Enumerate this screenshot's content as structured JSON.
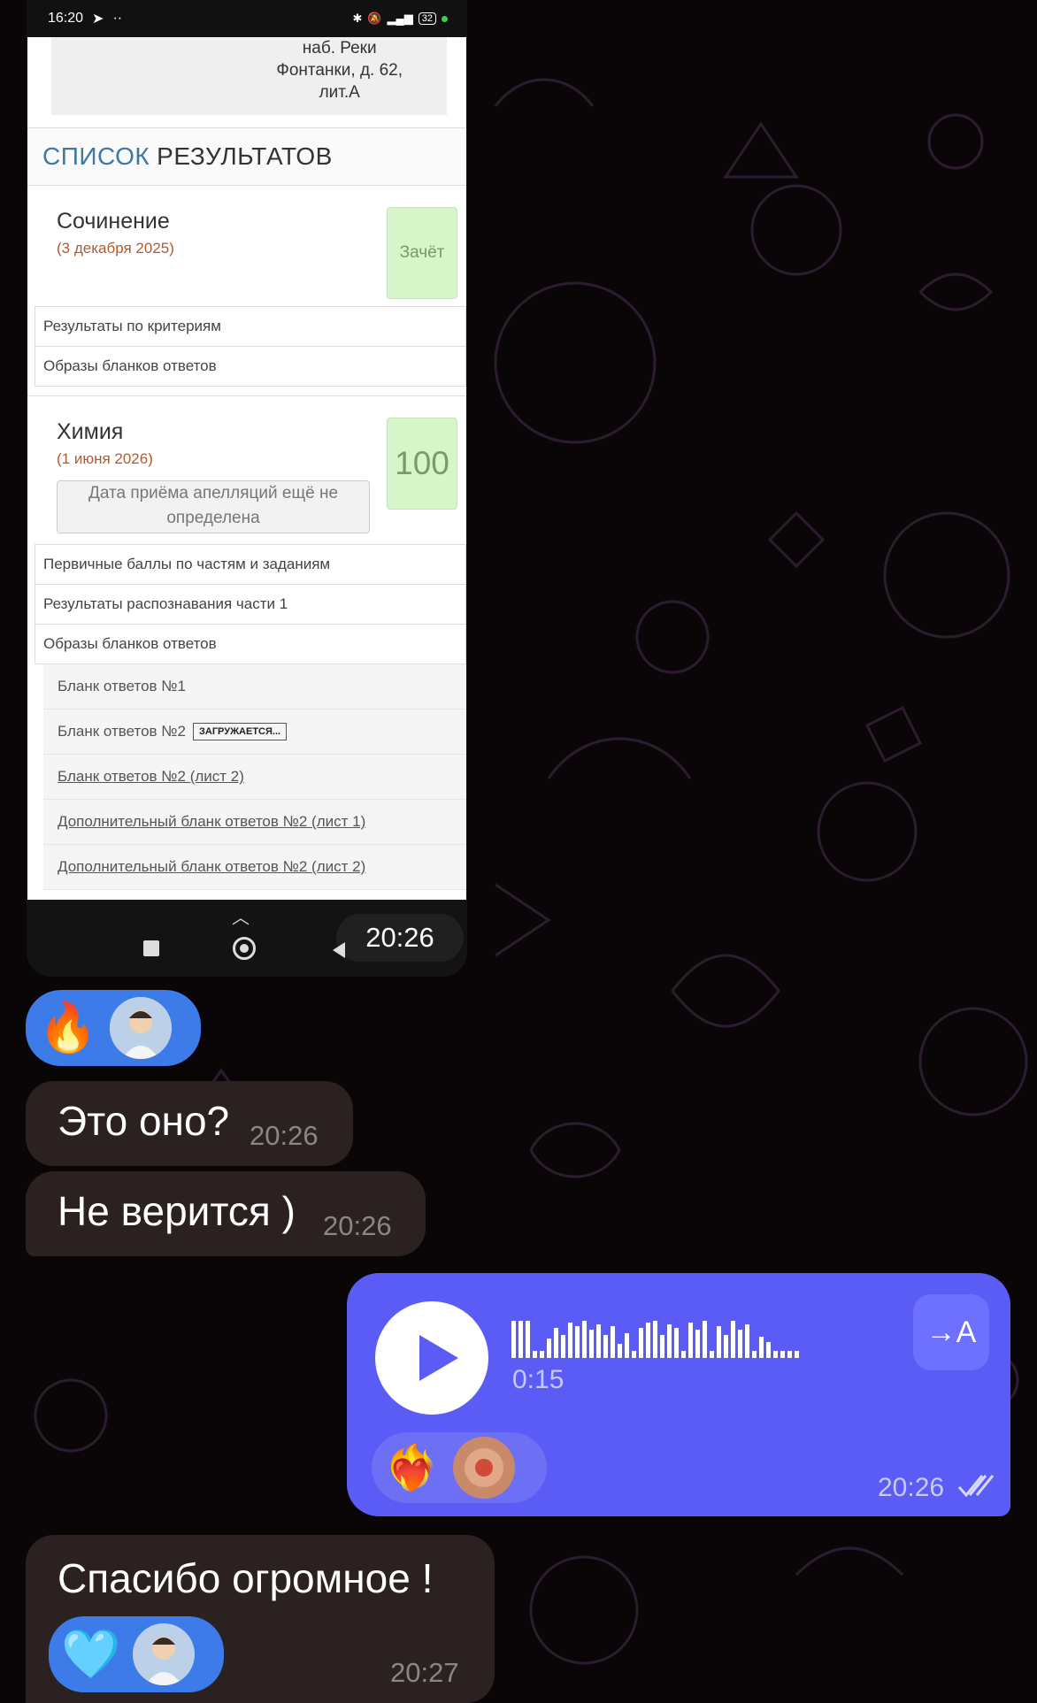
{
  "screenshot": {
    "status_bar": {
      "time": "16:20",
      "icons": [
        "telegram-icon",
        "more-dots-icon",
        "bluetooth-icon",
        "mute-icon",
        "signal-icon"
      ],
      "battery": "32"
    },
    "address_text": "наб. Реки\nФонтанки, д. 62,\nлит.А",
    "results_header": {
      "part1": "СПИСОК",
      "part2": "РЕЗУЛЬТАТОВ"
    },
    "exams": [
      {
        "name": "Сочинение",
        "date": "(3 декабря 2025)",
        "score": "Зачёт",
        "rows": [
          "Результаты по критериям",
          "Образы бланков ответов"
        ]
      },
      {
        "name": "Химия",
        "date": "(1 июня 2026)",
        "score": "100",
        "appeal": "Дата приёма апелляций ещё не определена",
        "rows": [
          "Первичные баллы по частям и заданиям",
          "Результаты распознавания части 1",
          "Образы бланков ответов"
        ],
        "forms": [
          "Бланк ответов №1",
          "Бланк ответов №2",
          "Бланк ответов №2 (лист 2)",
          "Дополнительный бланк ответов №2 (лист 1)",
          "Дополнительный бланк ответов №2 (лист 2)"
        ],
        "loading_label": "ЗАГРУЖАЕТСЯ..."
      }
    ],
    "image_time": "20:26"
  },
  "chat": {
    "image_reactions": [
      "🔥"
    ],
    "messages_in": [
      {
        "text": "Это оно?",
        "time": "20:26"
      },
      {
        "text": "Не верится )",
        "time": "20:26"
      }
    ],
    "voice": {
      "duration": "0:15",
      "transcribe_label": "→A",
      "time": "20:26",
      "reaction": "❤️‍🔥"
    },
    "last_message": {
      "text": "Спасибо огромное !",
      "time": "20:27",
      "reaction": "🩵"
    }
  },
  "colors": {
    "accent_blue": "#3d7ce8",
    "outgoing_bubble": "#5a5cf5",
    "incoming_bubble": "#2a2120",
    "score_green": "#d6f5c8"
  }
}
